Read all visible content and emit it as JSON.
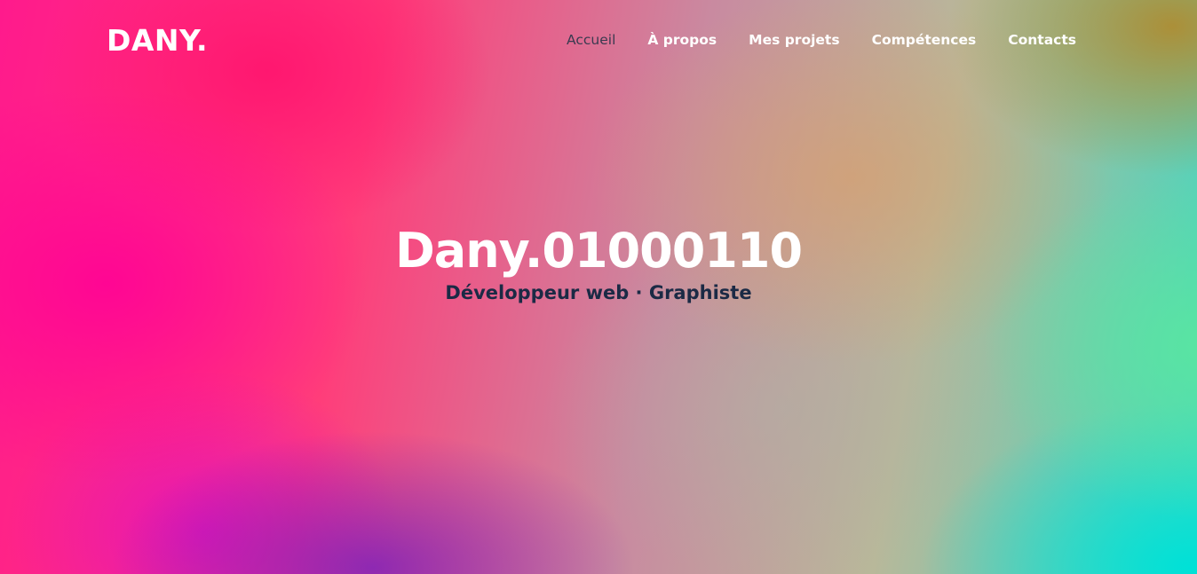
{
  "header": {
    "logo": "DANY."
  },
  "nav": {
    "items": [
      {
        "label": "Accueil",
        "active": true
      },
      {
        "label": "À propos",
        "active": false
      },
      {
        "label": "Mes projets",
        "active": false
      },
      {
        "label": "Compétences",
        "active": false
      },
      {
        "label": "Contacts",
        "active": false
      }
    ]
  },
  "hero": {
    "title": "Dany.01000110",
    "subtitle": "Développeur web · Graphiste"
  },
  "colors": {
    "nav_active": "#3a3a50",
    "subtitle": "#1b2a45",
    "text_light": "#ffffff"
  }
}
